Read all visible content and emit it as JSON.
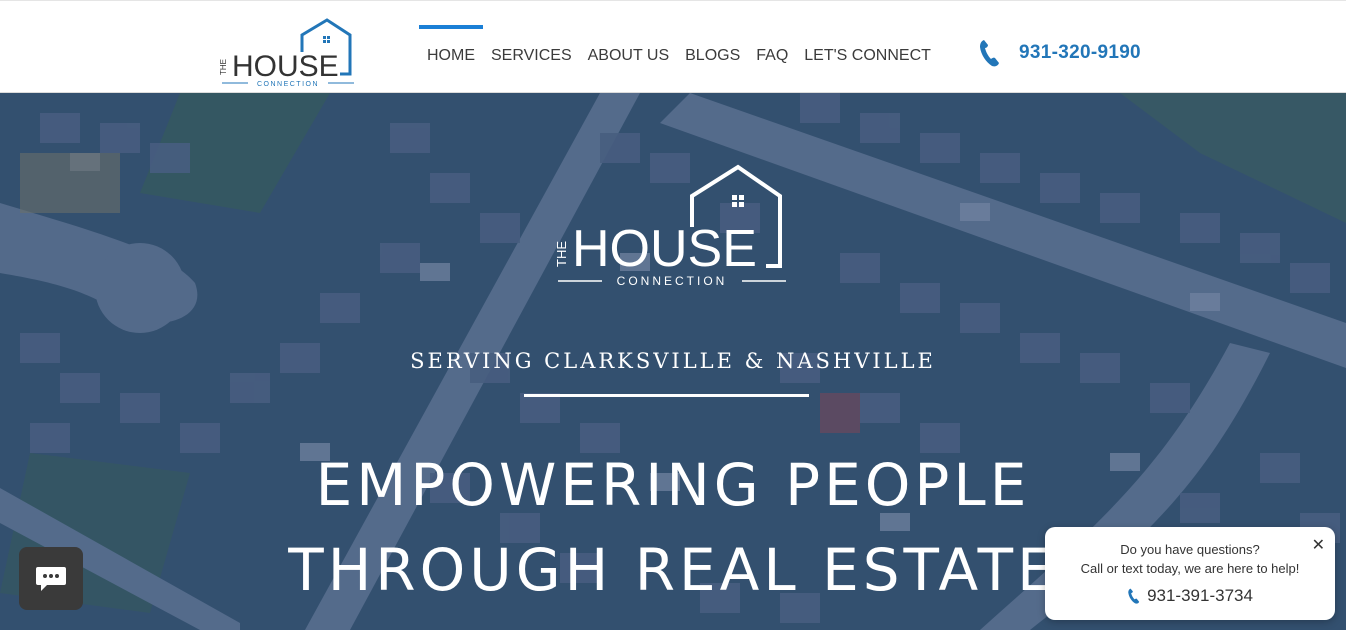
{
  "header": {
    "logo": {
      "the": "THE",
      "house": "HOUSE",
      "connection": "CONNECTION"
    },
    "nav": [
      {
        "label": "HOME",
        "active": true
      },
      {
        "label": "SERVICES"
      },
      {
        "label": "ABOUT US"
      },
      {
        "label": "BLOGS"
      },
      {
        "label": "FAQ"
      },
      {
        "label": "LET'S CONNECT"
      }
    ],
    "phone": "931-320-9190"
  },
  "hero": {
    "logo": {
      "the": "THE",
      "house": "HOUSE",
      "connection": "CONNECTION"
    },
    "tagline": "SERVING CLARKSVILLE & NASHVILLE",
    "headline_line1": "EMPOWERING PEOPLE",
    "headline_line2": "THROUGH REAL ESTATE"
  },
  "chat": {
    "button_icon": "chat-bubble-icon",
    "popup": {
      "line1": "Do you have questions?",
      "line2": "Call or text today, we are here to help!",
      "phone": "931-391-3734",
      "close": "✕"
    }
  },
  "colors": {
    "accent": "#1a7fd6",
    "phone_text": "#2276b8",
    "hero_overlay": "#2d4868"
  }
}
